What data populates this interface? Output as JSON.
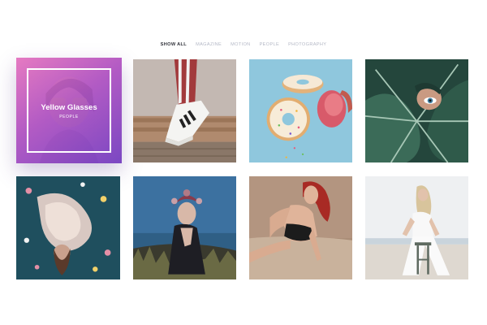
{
  "filters": {
    "items": [
      {
        "label": "SHOW ALL",
        "active": true
      },
      {
        "label": "MAGAZINE",
        "active": false
      },
      {
        "label": "MOTION",
        "active": false
      },
      {
        "label": "PEOPLE",
        "active": false
      },
      {
        "label": "PHOTOGRAPHY",
        "active": false
      }
    ]
  },
  "gallery": {
    "featured": {
      "title": "Yellow Glasses",
      "category": "PEOPLE"
    }
  },
  "colors": {
    "active_filter": "#2e3038",
    "inactive_filter": "#b4b8c6",
    "overlay_gradient_start": "#ec78c4",
    "overlay_gradient_end": "#7642c4"
  }
}
